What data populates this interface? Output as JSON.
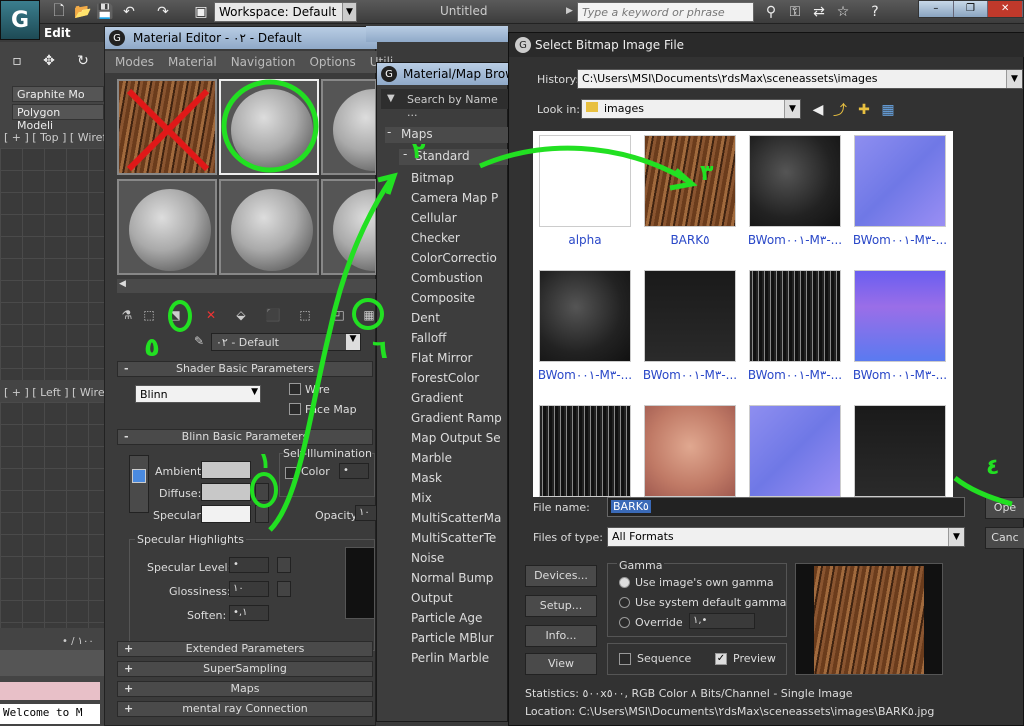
{
  "topbar": {
    "logo": "G",
    "workspace": "Workspace: Default",
    "doc_title": "Untitled",
    "search_placeholder": "Type a keyword or phrase",
    "win_buttons": [
      "–",
      "❐",
      "✕"
    ]
  },
  "left": {
    "edit_label": "Edit",
    "ribbon": [
      "Graphite Mo",
      "Polygon Modeli"
    ],
    "viewport_top": "[ + ] [ Top ] [ Wirefra",
    "viewport_left": "[ + ] [ Left ] [ Wirefra",
    "frame": "• / ١٠٠",
    "status": "Welcome to M"
  },
  "material_editor": {
    "title": "Material Editor - ٠٢ - Default",
    "menu": [
      "Modes",
      "Material",
      "Navigation",
      "Options",
      "Utili"
    ],
    "current_material": "٠٢ - Default",
    "rollouts": [
      "Shader Basic Parameters",
      "Blinn Basic Parameters",
      "Extended Parameters",
      "SuperSampling",
      "Maps",
      "mental ray Connection"
    ],
    "shader": "Blinn",
    "wire": "Wire",
    "face_map": "Face Map",
    "self_illum": "Self-Illumination",
    "color": "Color",
    "color_val": "•",
    "ambient": "Ambient:",
    "diffuse": "Diffuse:",
    "specular": "Specular:",
    "opacity": "Opacity:",
    "opacity_val": "١٠",
    "spec_highlights": "Specular Highlights",
    "spec_level": "Specular Level:",
    "spec_level_val": "•",
    "glossiness": "Glossiness:",
    "glossiness_val": "١٠",
    "soften": "Soften:",
    "soften_val": "•,١"
  },
  "map_browser": {
    "title": "Material/Map Brow",
    "search": "Search by Name ...",
    "group": "Maps",
    "subgroup": "Standard",
    "items": [
      {
        "label": "Bitmap",
        "swatch": "#000000"
      },
      {
        "label": "Camera Map P",
        "swatch": "#000000"
      },
      {
        "label": "Cellular",
        "swatch": "#777777"
      },
      {
        "label": "Checker",
        "swatch": "#ffffff"
      },
      {
        "label": "ColorCorrectio",
        "swatch": "#000000"
      },
      {
        "label": "Combustion",
        "swatch": "#000000"
      },
      {
        "label": "Composite",
        "swatch": "#000000"
      },
      {
        "label": "Dent",
        "swatch": "#888888"
      },
      {
        "label": "Falloff",
        "swatch": "#cccccc"
      },
      {
        "label": "Flat Mirror",
        "swatch": "#000000"
      },
      {
        "label": "ForestColor",
        "swatch": "#ffffff"
      },
      {
        "label": "Gradient",
        "swatch": "#999999"
      },
      {
        "label": "Gradient Ramp",
        "swatch": "#777777"
      },
      {
        "label": "Map Output Se",
        "swatch": "#000000"
      },
      {
        "label": "Marble",
        "swatch": "#d8d0b8"
      },
      {
        "label": "Mask",
        "swatch": "#ffffff"
      },
      {
        "label": "Mix",
        "swatch": "#000000"
      },
      {
        "label": "MultiScatterMa",
        "swatch": "#ffffff"
      },
      {
        "label": "MultiScatterTe",
        "swatch": "#ffffff"
      },
      {
        "label": "Noise",
        "swatch": "#bbbbbb"
      },
      {
        "label": "Normal Bump",
        "swatch": "#9a9ae8"
      },
      {
        "label": "Output",
        "swatch": "#ffffff"
      },
      {
        "label": "Particle Age",
        "swatch": "#000000"
      },
      {
        "label": "Particle MBlur",
        "swatch": "#000000"
      },
      {
        "label": "Perlin Marble",
        "swatch": "#bfbfa0"
      }
    ]
  },
  "bitmap_dialog": {
    "title": "Select Bitmap Image File",
    "history_label": "History:",
    "history_value": "C:\\Users\\MSI\\Documents\\٢dsMax\\sceneassets\\images",
    "lookin_label": "Look in:",
    "lookin_value": "images",
    "files": [
      {
        "name": "alpha",
        "kind": "white"
      },
      {
        "name": "BARK٥",
        "kind": "bark"
      },
      {
        "name": "BWom٠٠١-M٣-...",
        "kind": "dark"
      },
      {
        "name": "BWom٠٠١-M٣-...",
        "kind": "blue"
      },
      {
        "name": "BWom٠٠١-M٣-...",
        "kind": "dark"
      },
      {
        "name": "BWom٠٠١-M٣-...",
        "kind": "black"
      },
      {
        "name": "BWom٠٠١-M٣-...",
        "kind": "hair"
      },
      {
        "name": "BWom٠٠١-M٣-...",
        "kind": "purple"
      },
      {
        "name": "",
        "kind": "hair"
      },
      {
        "name": "",
        "kind": "skin"
      },
      {
        "name": "",
        "kind": "blue"
      },
      {
        "name": "",
        "kind": "black"
      }
    ],
    "filename_label": "File name:",
    "filename_value": "BARK٥",
    "filetype_label": "Files of type:",
    "filetype_value": "All Formats",
    "open": "Ope",
    "cancel": "Canc",
    "devices": "Devices...",
    "setup": "Setup...",
    "info": "Info...",
    "view": "View",
    "gamma_label": "Gamma",
    "gamma_opt1": "Use image's own gamma",
    "gamma_opt2": "Use system default gamma",
    "gamma_opt3": "Override",
    "gamma_override_val": "١,•",
    "sequence": "Sequence",
    "preview": "Preview",
    "statistics": "Statistics:  ٥٠٠x٥٠٠, RGB Color ٨ Bits/Channel - Single Image",
    "location": "Location:  C:\\Users\\MSI\\Documents\\٢dsMax\\sceneassets\\images\\BARK٥.jpg"
  },
  "annotations": [
    "١",
    "٢",
    "٣",
    "٤",
    "٥",
    "٦"
  ],
  "colors": {
    "annotation": "#22e022",
    "title_bar": "#a9bfda"
  }
}
